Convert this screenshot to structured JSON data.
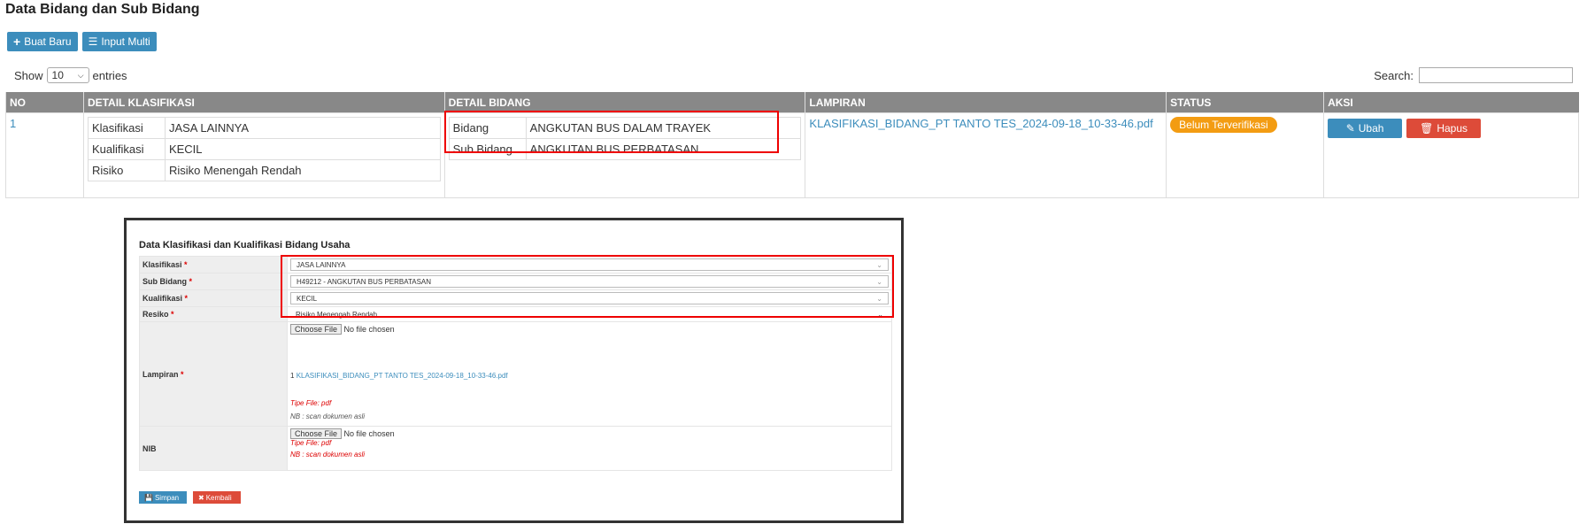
{
  "page": {
    "title": "Data Bidang dan Sub Bidang"
  },
  "toolbar": {
    "create_label": "Buat Baru",
    "multi_label": "Input Multi"
  },
  "length_menu": {
    "show": "Show",
    "value": "10",
    "entries": "entries"
  },
  "search": {
    "label": "Search:",
    "placeholder": ""
  },
  "table": {
    "headers": [
      "NO",
      "DETAIL KLASIFIKASI",
      "DETAIL BIDANG",
      "LAMPIRAN",
      "STATUS",
      "AKSI"
    ],
    "row": {
      "no": "1",
      "klasifikasi": [
        {
          "label": "Klasifikasi",
          "value": "JASA LAINNYA"
        },
        {
          "label": "Kualifikasi",
          "value": "KECIL"
        },
        {
          "label": "Risiko",
          "value": "Risiko Menengah Rendah"
        }
      ],
      "bidang": [
        {
          "label": "Bidang",
          "value": "ANGKUTAN BUS DALAM TRAYEK"
        },
        {
          "label": "Sub Bidang",
          "value": "ANGKUTAN BUS PERBATASAN"
        }
      ],
      "lampiran": "KLASIFIKASI_BIDANG_PT TANTO TES_2024-09-18_10-33-46.pdf",
      "status": "Belum Terverifikasi",
      "edit_label": "Ubah",
      "delete_label": "Hapus"
    }
  },
  "form": {
    "title": "Data Klasifikasi dan Kualifikasi Bidang Usaha",
    "klasifikasi_label": "Klasifikasi",
    "klasifikasi_value": "JASA LAINNYA",
    "sub_bidang_label": "Sub Bidang",
    "sub_bidang_value": "H49212 - ANGKUTAN BUS PERBATASAN",
    "kualifikasi_label": "Kualifikasi",
    "kualifikasi_value": "KECIL",
    "resiko_label": "Resiko",
    "resiko_value": "Risiko Menengah Rendah",
    "lampiran_label": "Lampiran",
    "choose_file": "Choose File",
    "no_file": "No file chosen",
    "lampiran_no": "1",
    "lampiran_file": "KLASIFIKASI_BIDANG_PT TANTO TES_2024-09-18_10-33-46.pdf",
    "tipe_file": "Tipe File: pdf",
    "nb_note": "NB : scan dokumen asli",
    "nib_label": "NIB",
    "save_label": "Simpan",
    "back_label": "Kembali",
    "required": "*"
  },
  "colors": {
    "primary": "#3c8dbc",
    "danger": "#dd4b39",
    "warning": "#f39c12",
    "header": "#888888",
    "highlight": "#e00000"
  }
}
